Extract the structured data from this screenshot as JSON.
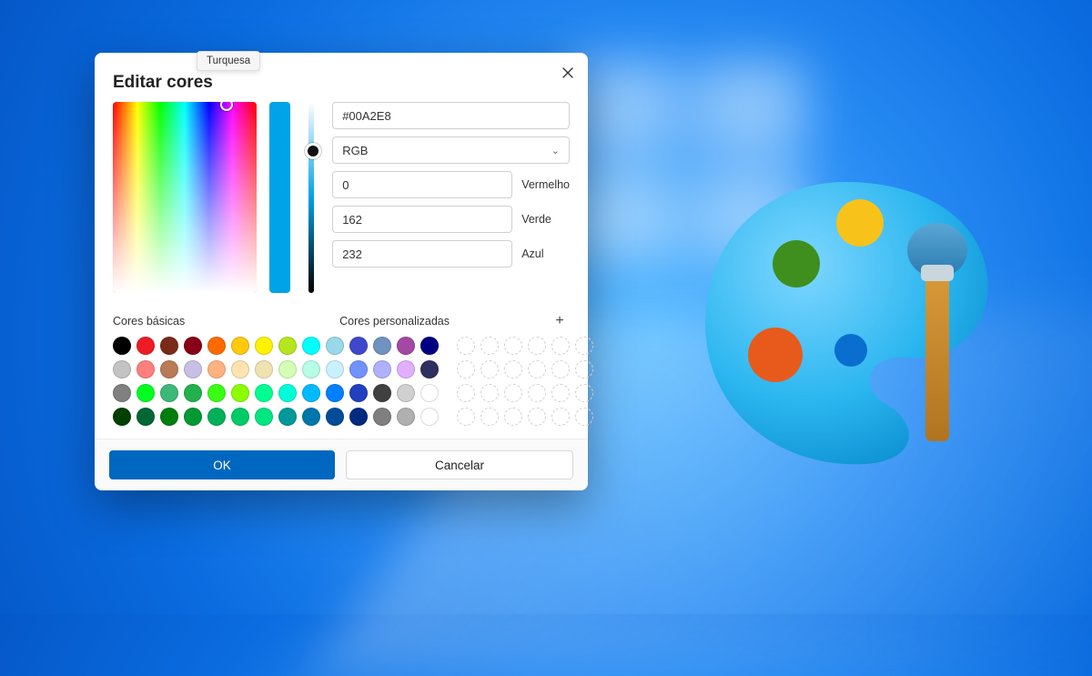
{
  "dialog": {
    "title": "Editar cores",
    "tooltip": "Turquesa",
    "hex": "#00A2E8",
    "mode": "RGB",
    "channels": {
      "r": {
        "value": "0",
        "label": "Vermelho"
      },
      "g": {
        "value": "162",
        "label": "Verde"
      },
      "b": {
        "value": "232",
        "label": "Azul"
      }
    },
    "sections": {
      "basic": "Cores básicas",
      "custom": "Cores personalizadas"
    },
    "basic_colors": [
      "#000000",
      "#ed1c24",
      "#7a2b18",
      "#880015",
      "#ff6a00",
      "#ffc90e",
      "#fff200",
      "#b5e61d",
      "#00ffff",
      "#99d9ea",
      "#3f48cc",
      "#7092be",
      "#a349a4",
      "#000080",
      "#c3c3c3",
      "#ff7f7f",
      "#b97a57",
      "#c8bfe7",
      "#ffb27f",
      "#ffe4b0",
      "#efe4b0",
      "#d4ffb5",
      "#b5ffe6",
      "#c8f2ff",
      "#7092ff",
      "#b0b0ff",
      "#e0b0ff",
      "#303060",
      "#808080",
      "#00ff21",
      "#3cb878",
      "#22b14c",
      "#39ff14",
      "#8cff00",
      "#00ff90",
      "#00ffd8",
      "#00baff",
      "#0080ff",
      "#2040c0",
      "#404040",
      "#d0d0d0",
      "#ffffff",
      "#004000",
      "#006633",
      "#007f0e",
      "#009933",
      "#00b159",
      "#00cc66",
      "#00e680",
      "#009999",
      "#0077aa",
      "#004c99",
      "#002b80",
      "#7f7f7f",
      "#b0b0b0",
      "#ffffff"
    ],
    "custom_slots": 24,
    "buttons": {
      "ok": "OK",
      "cancel": "Cancelar"
    },
    "preview_color": "#00A2E8"
  }
}
